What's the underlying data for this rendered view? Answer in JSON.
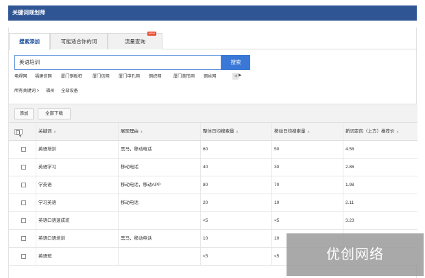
{
  "title": "关键词规划师",
  "tabs": [
    {
      "label": "搜索添加",
      "active": true
    },
    {
      "label": "可能适合你的词",
      "active": false
    },
    {
      "label": "流量查询",
      "active": false,
      "badge": "NEW"
    }
  ],
  "search": {
    "value": "英语培训",
    "button": "搜索"
  },
  "quick_links": [
    "电焊网",
    "福建信网",
    "厦门钢板桩",
    "厦门信网",
    "厦门中孔网",
    "钢织网",
    "厦门美形网",
    "钢丝网"
  ],
  "breadcrumb": [
    "所有关键词 >",
    "福州",
    "全部设备"
  ],
  "toolbar": {
    "add": "添加",
    "download_all": "全部下载"
  },
  "table": {
    "headers": [
      "关键词",
      "展现理由",
      "整体日均搜索量",
      "移动日均搜索量",
      "新词定向（上方）推荐价"
    ],
    "rows": [
      {
        "keyword": "英语培训",
        "reason": "黑马，移动电话",
        "total": "60",
        "mobile": "50",
        "price": "4.58"
      },
      {
        "keyword": "英语学习",
        "reason": "移动电话",
        "total": "40",
        "mobile": "30",
        "price": "2.86"
      },
      {
        "keyword": "学英语",
        "reason": "移动电话，移动APP",
        "total": "80",
        "mobile": "70",
        "price": "1.98"
      },
      {
        "keyword": "学习英语",
        "reason": "移动电话",
        "total": "20",
        "mobile": "10",
        "price": "2.11"
      },
      {
        "keyword": "英语口语速成班",
        "reason": "",
        "total": "<5",
        "mobile": "<5",
        "price": "3.23"
      },
      {
        "keyword": "英语口语培训",
        "reason": "黑马，移动电话",
        "total": "10",
        "mobile": "10",
        "price": ""
      },
      {
        "keyword": "英语班",
        "reason": "",
        "total": "<5",
        "mobile": "<5",
        "price": ""
      }
    ]
  },
  "watermark": "优创网络",
  "colors": {
    "title_bar": "#2f5594",
    "search_button": "#3978d6",
    "badge": "#e84a2e"
  }
}
